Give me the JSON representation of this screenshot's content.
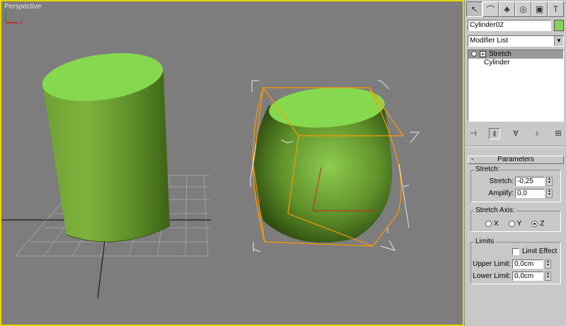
{
  "viewport": {
    "label": "Perspective",
    "axis_x": "x",
    "axis_z": "z",
    "colors": {
      "background": "#7d7d7d",
      "object": "#86c24a",
      "selection": "#ff9a00",
      "border": "#e8d400"
    }
  },
  "panel": {
    "tabs": [
      {
        "name": "create-tab",
        "icon": "pointer-icon",
        "glyph": "↖"
      },
      {
        "name": "modify-tab",
        "icon": "bend-icon",
        "glyph": "⌒"
      },
      {
        "name": "hierarchy-tab",
        "icon": "hierarchy-icon",
        "glyph": "♣"
      },
      {
        "name": "motion-tab",
        "icon": "motion-icon",
        "glyph": "◎"
      },
      {
        "name": "display-tab",
        "icon": "display-icon",
        "glyph": "▣"
      },
      {
        "name": "utilities-tab",
        "icon": "hammer-icon",
        "glyph": "T"
      }
    ],
    "object_name": "Cylinder02",
    "object_color": "#86d25a",
    "modifier_list_label": "Modifier List",
    "stack": {
      "modifier": "Stretch",
      "base": "Cylinder"
    },
    "stack_tools": [
      {
        "name": "pin-stack-icon",
        "glyph": "⊣"
      },
      {
        "name": "show-end-result-icon",
        "glyph": "‖"
      },
      {
        "name": "make-unique-icon",
        "glyph": "∀"
      },
      {
        "name": "remove-modifier-icon",
        "glyph": "♁"
      },
      {
        "name": "configure-sets-icon",
        "glyph": "⊞"
      }
    ],
    "rollout": {
      "title": "Parameters",
      "stretch_group": {
        "title": "Stretch:",
        "stretch_label": "Stretch:",
        "stretch_value": "-0,25",
        "amplify_label": "Amplify:",
        "amplify_value": "0,0"
      },
      "axis_group": {
        "title": "Stretch Axis:",
        "options": [
          "X",
          "Y",
          "Z"
        ],
        "selected": "Z"
      },
      "limits_group": {
        "title": "Limits",
        "limit_effect_label": "Limit Effect",
        "upper_label": "Upper Limit:",
        "upper_value": "0,0cm",
        "lower_label": "Lower Limit:",
        "lower_value": "0,0cm"
      }
    }
  }
}
